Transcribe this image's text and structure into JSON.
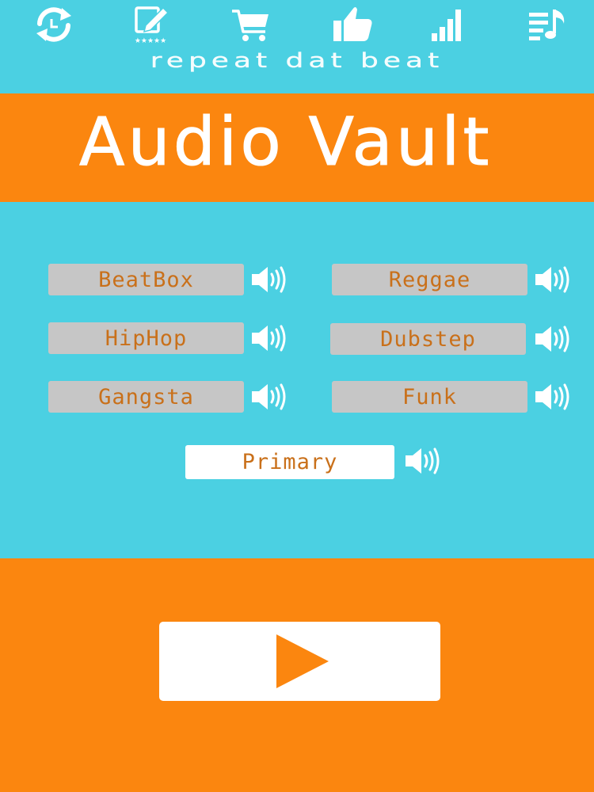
{
  "colors": {
    "cyan": "#4bd0e2",
    "orange": "#fb860f",
    "label_text": "#c9701a",
    "button_bg": "#c6c6c6",
    "selected_bg": "#ffffff",
    "white": "#ffffff"
  },
  "toolbar": {
    "icons": [
      "refresh-icon",
      "rate-icon",
      "cart-icon",
      "thumbs-up-icon",
      "signal-icon",
      "playlist-icon"
    ],
    "rate_stars": "★★★★★"
  },
  "header": {
    "tagline": "repeat dat beat",
    "title": "Audio Vault"
  },
  "genres": [
    {
      "label": "BeatBox"
    },
    {
      "label": "Reggae"
    },
    {
      "label": "HipHop"
    },
    {
      "label": "Dubstep"
    },
    {
      "label": "Gangsta"
    },
    {
      "label": "Funk"
    },
    {
      "label": "Primary",
      "selected": true
    }
  ],
  "player": {
    "play_icon": "play-icon"
  }
}
